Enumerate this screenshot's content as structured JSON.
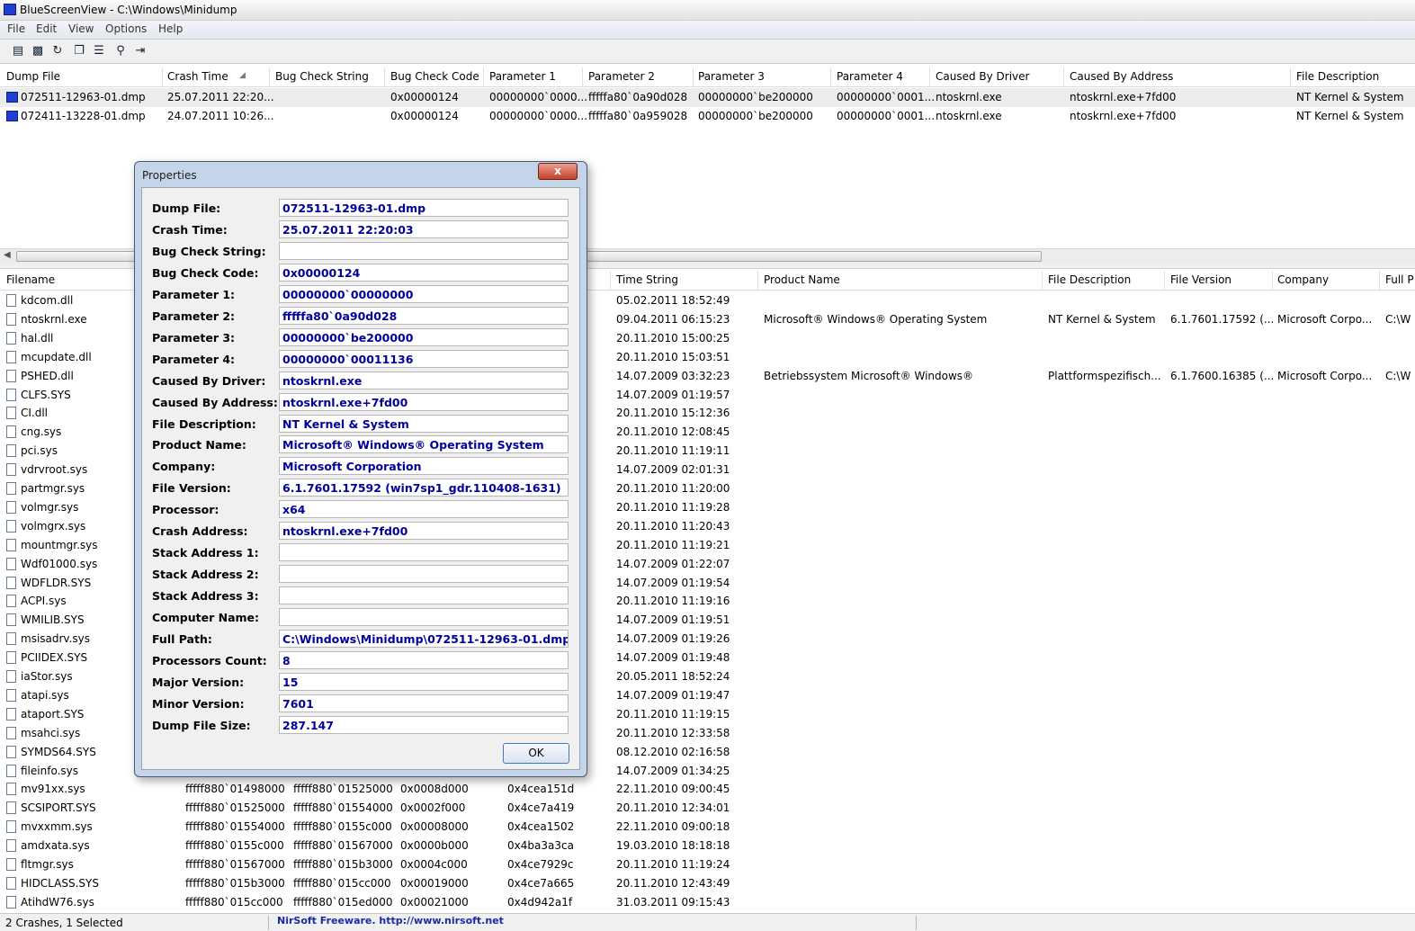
{
  "window": {
    "title": "BlueScreenView  -  C:\\Windows\\Minidump"
  },
  "menu": [
    "File",
    "Edit",
    "View",
    "Options",
    "Help"
  ],
  "toolbar_icons": [
    "select-columns-icon",
    "save-icon",
    "refresh-icon",
    "copy-icon",
    "properties-icon",
    "find-icon",
    "exit-icon"
  ],
  "upper_table": {
    "columns": [
      "Dump File",
      "Crash Time",
      "Bug Check String",
      "Bug Check Code",
      "Parameter 1",
      "Parameter 2",
      "Parameter 3",
      "Parameter 4",
      "Caused By Driver",
      "Caused By Address",
      "File Description"
    ],
    "rows": [
      [
        "072511-12963-01.dmp",
        "25.07.2011 22:20...",
        "",
        "0x00000124",
        "00000000`0000...",
        "fffffa80`0a90d028",
        "00000000`be200000",
        "00000000`0001...",
        "ntoskrnl.exe",
        "ntoskrnl.exe+7fd00",
        "NT Kernel & System"
      ],
      [
        "072411-13228-01.dmp",
        "24.07.2011 10:26...",
        "",
        "0x00000124",
        "00000000`0000...",
        "fffffa80`0a959028",
        "00000000`be200000",
        "00000000`0001...",
        "ntoskrnl.exe",
        "ntoskrnl.exe+7fd00",
        "NT Kernel & System"
      ]
    ]
  },
  "lower_table": {
    "columns": [
      "Filename",
      "Time String",
      "Product Name",
      "File Description",
      "File Version",
      "Company",
      "Full P"
    ],
    "rows": [
      {
        "file": "kdcom.dll",
        "time": "05.02.2011 18:52:49"
      },
      {
        "file": "ntoskrnl.exe",
        "time": "09.04.2011 06:15:23",
        "product": "Microsoft® Windows® Operating System",
        "desc": "NT Kernel & System",
        "ver": "6.1.7601.17592 (...",
        "company": "Microsoft Corpo...",
        "path": "C:\\W"
      },
      {
        "file": "hal.dll",
        "time": "20.11.2010 15:00:25"
      },
      {
        "file": "mcupdate.dll",
        "time": "20.11.2010 15:03:51"
      },
      {
        "file": "PSHED.dll",
        "time": "14.07.2009 03:32:23",
        "product": "Betriebssystem Microsoft® Windows®",
        "desc": "Plattformspezifisch...",
        "ver": "6.1.7600.16385 (...",
        "company": "Microsoft Corpo...",
        "path": "C:\\W"
      },
      {
        "file": "CLFS.SYS",
        "time": "14.07.2009 01:19:57"
      },
      {
        "file": "CI.dll",
        "time": "20.11.2010 15:12:36"
      },
      {
        "file": "cng.sys",
        "time": "20.11.2010 12:08:45"
      },
      {
        "file": "pci.sys",
        "time": "20.11.2010 11:19:11"
      },
      {
        "file": "vdrvroot.sys",
        "time": "14.07.2009 02:01:31"
      },
      {
        "file": "partmgr.sys",
        "time": "20.11.2010 11:20:00"
      },
      {
        "file": "volmgr.sys",
        "time": "20.11.2010 11:19:28"
      },
      {
        "file": "volmgrx.sys",
        "time": "20.11.2010 11:20:43"
      },
      {
        "file": "mountmgr.sys",
        "time": "20.11.2010 11:19:21"
      },
      {
        "file": "Wdf01000.sys",
        "time": "14.07.2009 01:22:07"
      },
      {
        "file": "WDFLDR.SYS",
        "time": "14.07.2009 01:19:54"
      },
      {
        "file": "ACPI.sys",
        "time": "20.11.2010 11:19:16"
      },
      {
        "file": "WMILIB.SYS",
        "time": "14.07.2009 01:19:51"
      },
      {
        "file": "msisadrv.sys",
        "time": "14.07.2009 01:19:26"
      },
      {
        "file": "PCIIDEX.SYS",
        "time": "14.07.2009 01:19:48"
      },
      {
        "file": "iaStor.sys",
        "time": "20.05.2011 18:52:24"
      },
      {
        "file": "atapi.sys",
        "time": "14.07.2009 01:19:47"
      },
      {
        "file": "ataport.SYS",
        "time": "20.11.2010 11:19:15"
      },
      {
        "file": "msahci.sys",
        "time": "20.11.2010 12:33:58"
      },
      {
        "file": "SYMDS64.SYS",
        "time": "08.12.2010 02:16:58"
      },
      {
        "file": "fileinfo.sys",
        "time": "14.07.2009 01:34:25"
      },
      {
        "file": "mv91xx.sys",
        "base": "fffff880`01498000",
        "end": "fffff880`01525000",
        "size": "0x0008d000",
        "stamp": "0x4cea151d",
        "time": "22.11.2010 09:00:45"
      },
      {
        "file": "SCSIPORT.SYS",
        "base": "fffff880`01525000",
        "end": "fffff880`01554000",
        "size": "0x0002f000",
        "stamp": "0x4ce7a419",
        "time": "20.11.2010 12:34:01"
      },
      {
        "file": "mvxxmm.sys",
        "base": "fffff880`01554000",
        "end": "fffff880`0155c000",
        "size": "0x00008000",
        "stamp": "0x4cea1502",
        "time": "22.11.2010 09:00:18"
      },
      {
        "file": "amdxata.sys",
        "base": "fffff880`0155c000",
        "end": "fffff880`01567000",
        "size": "0x0000b000",
        "stamp": "0x4ba3a3ca",
        "time": "19.03.2010 18:18:18"
      },
      {
        "file": "fltmgr.sys",
        "base": "fffff880`01567000",
        "end": "fffff880`015b3000",
        "size": "0x0004c000",
        "stamp": "0x4ce7929c",
        "time": "20.11.2010 11:19:24"
      },
      {
        "file": "HIDCLASS.SYS",
        "base": "fffff880`015b3000",
        "end": "fffff880`015cc000",
        "size": "0x00019000",
        "stamp": "0x4ce7a665",
        "time": "20.11.2010 12:43:49"
      },
      {
        "file": "AtihdW76.sys",
        "base": "fffff880`015cc000",
        "end": "fffff880`015ed000",
        "size": "0x00021000",
        "stamp": "0x4d942a1f",
        "time": "31.03.2011 09:15:43"
      }
    ]
  },
  "properties_dialog": {
    "title": "Properties",
    "close_label": "x",
    "ok_label": "OK",
    "fields": [
      {
        "label": "Dump File:",
        "value": "072511-12963-01.dmp"
      },
      {
        "label": "Crash Time:",
        "value": "25.07.2011 22:20:03"
      },
      {
        "label": "Bug Check String:",
        "value": ""
      },
      {
        "label": "Bug Check Code:",
        "value": "0x00000124"
      },
      {
        "label": "Parameter 1:",
        "value": "00000000`00000000"
      },
      {
        "label": "Parameter 2:",
        "value": "fffffa80`0a90d028"
      },
      {
        "label": "Parameter 3:",
        "value": "00000000`be200000"
      },
      {
        "label": "Parameter 4:",
        "value": "00000000`00011136"
      },
      {
        "label": "Caused By Driver:",
        "value": "ntoskrnl.exe"
      },
      {
        "label": "Caused By Address:",
        "value": "ntoskrnl.exe+7fd00"
      },
      {
        "label": "File Description:",
        "value": "NT Kernel & System"
      },
      {
        "label": "Product Name:",
        "value": "Microsoft® Windows® Operating System"
      },
      {
        "label": "Company:",
        "value": "Microsoft Corporation"
      },
      {
        "label": "File Version:",
        "value": "6.1.7601.17592 (win7sp1_gdr.110408-1631)"
      },
      {
        "label": "Processor:",
        "value": "x64"
      },
      {
        "label": "Crash Address:",
        "value": "ntoskrnl.exe+7fd00"
      },
      {
        "label": "Stack Address 1:",
        "value": ""
      },
      {
        "label": "Stack Address 2:",
        "value": ""
      },
      {
        "label": "Stack Address 3:",
        "value": ""
      },
      {
        "label": "Computer Name:",
        "value": ""
      },
      {
        "label": "Full Path:",
        "value": "C:\\Windows\\Minidump\\072511-12963-01.dmp"
      },
      {
        "label": "Processors Count:",
        "value": "8"
      },
      {
        "label": "Major Version:",
        "value": "15"
      },
      {
        "label": "Minor Version:",
        "value": "7601"
      },
      {
        "label": "Dump File Size:",
        "value": "287.147"
      }
    ]
  },
  "status": {
    "count_text": "2 Crashes, 1 Selected",
    "link_text": "NirSoft Freeware.  http://www.nirsoft.net"
  }
}
